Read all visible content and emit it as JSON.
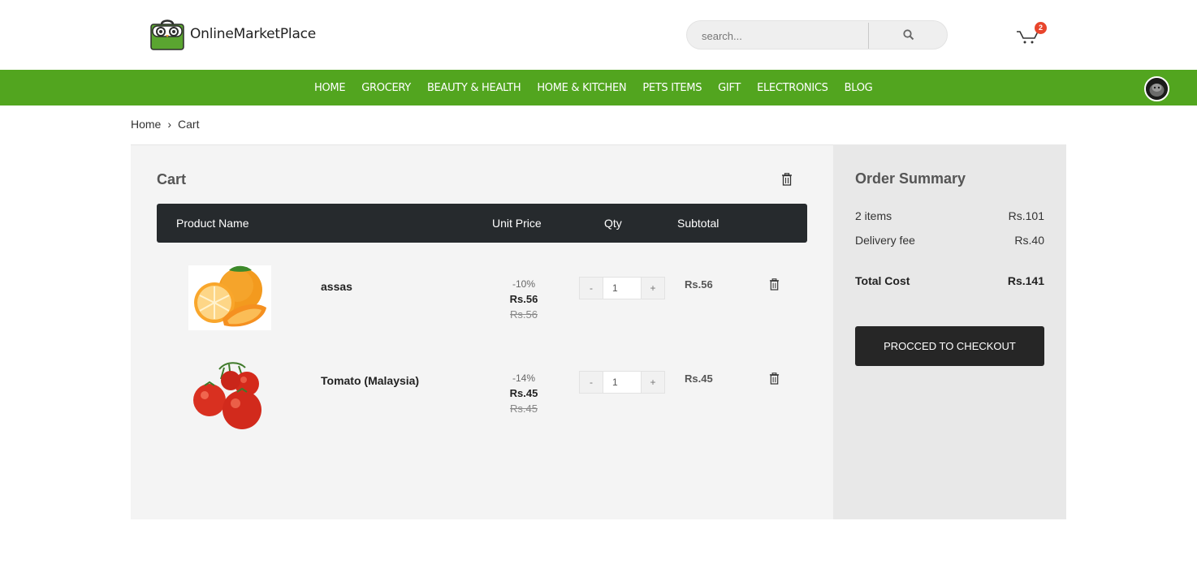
{
  "header": {
    "logo_text": "OnlineMarketPlace",
    "search_placeholder": "search...",
    "cart_count": "2"
  },
  "nav": {
    "items": [
      "HOME",
      "GROCERY",
      "BEAUTY & HEALTH",
      "HOME & KITCHEN",
      "PETS ITEMS",
      "GIFT",
      "ELECTRONICS",
      "BLOG"
    ]
  },
  "breadcrumb": {
    "home": "Home",
    "separator": "›",
    "current": "Cart"
  },
  "cart": {
    "title": "Cart",
    "columns": {
      "product": "Product Name",
      "unit_price": "Unit Price",
      "qty": "Qty",
      "subtotal": "Subtotal"
    },
    "items": [
      {
        "name": "assas",
        "discount": "-10%",
        "price": "Rs.56",
        "old_price": "Rs.56",
        "qty": "1",
        "subtotal": "Rs.56",
        "image": "orange-image"
      },
      {
        "name": "Tomato (Malaysia)",
        "discount": "-14%",
        "price": "Rs.45",
        "old_price": "Rs.45",
        "qty": "1",
        "subtotal": "Rs.45",
        "image": "tomato-image"
      }
    ],
    "qty_minus": "-",
    "qty_plus": "+"
  },
  "summary": {
    "title": "Order Summary",
    "items_label": "2 items",
    "items_value": "Rs.101",
    "delivery_label": "Delivery fee",
    "delivery_value": "Rs.40",
    "total_label": "Total Cost",
    "total_value": "Rs.141",
    "checkout_label": "PROCCED TO CHECKOUT"
  },
  "colors": {
    "nav_bg": "#52a51f",
    "table_head_bg": "#262a2d",
    "checkout_bg": "#262626",
    "badge": "#e8452c"
  }
}
